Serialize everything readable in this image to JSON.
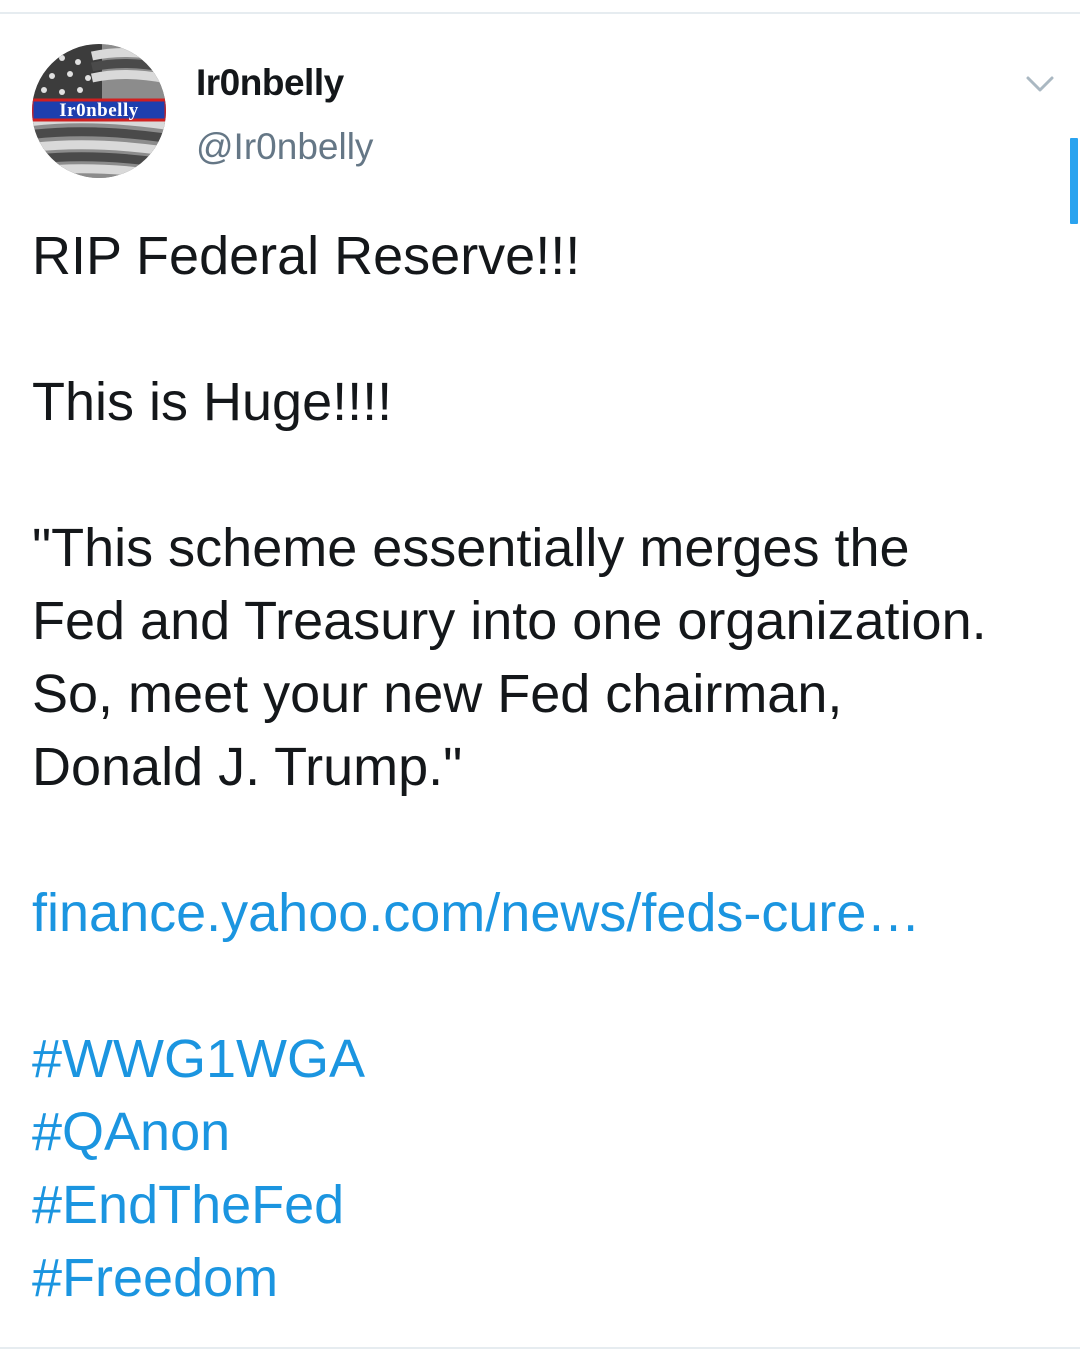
{
  "tweet": {
    "author": {
      "display_name": "Ir0nbelly",
      "handle": "@Ir0nbelly",
      "avatar_text": "Ir0nbelly"
    },
    "menu_icon": "chevron-down-icon",
    "lines": {
      "l1": "RIP Federal Reserve!!!",
      "l2": "This is Huge!!!!",
      "l3": "\"This scheme essentially merges the",
      "l4": "Fed and Treasury into one organization.",
      "l5": "So, meet your new Fed chairman,",
      "l6": "Donald J. Trump.\""
    },
    "link": "finance.yahoo.com/news/feds-cure…",
    "hashtags": [
      "#WWG1WGA",
      "#QAnon",
      "#EndTheFed",
      "#Freedom"
    ]
  },
  "colors": {
    "text": "#14171a",
    "secondary": "#657786",
    "link": "#1b95e0",
    "divider": "#e6ecf0",
    "scroll_indicator": "#2aa3ef"
  }
}
